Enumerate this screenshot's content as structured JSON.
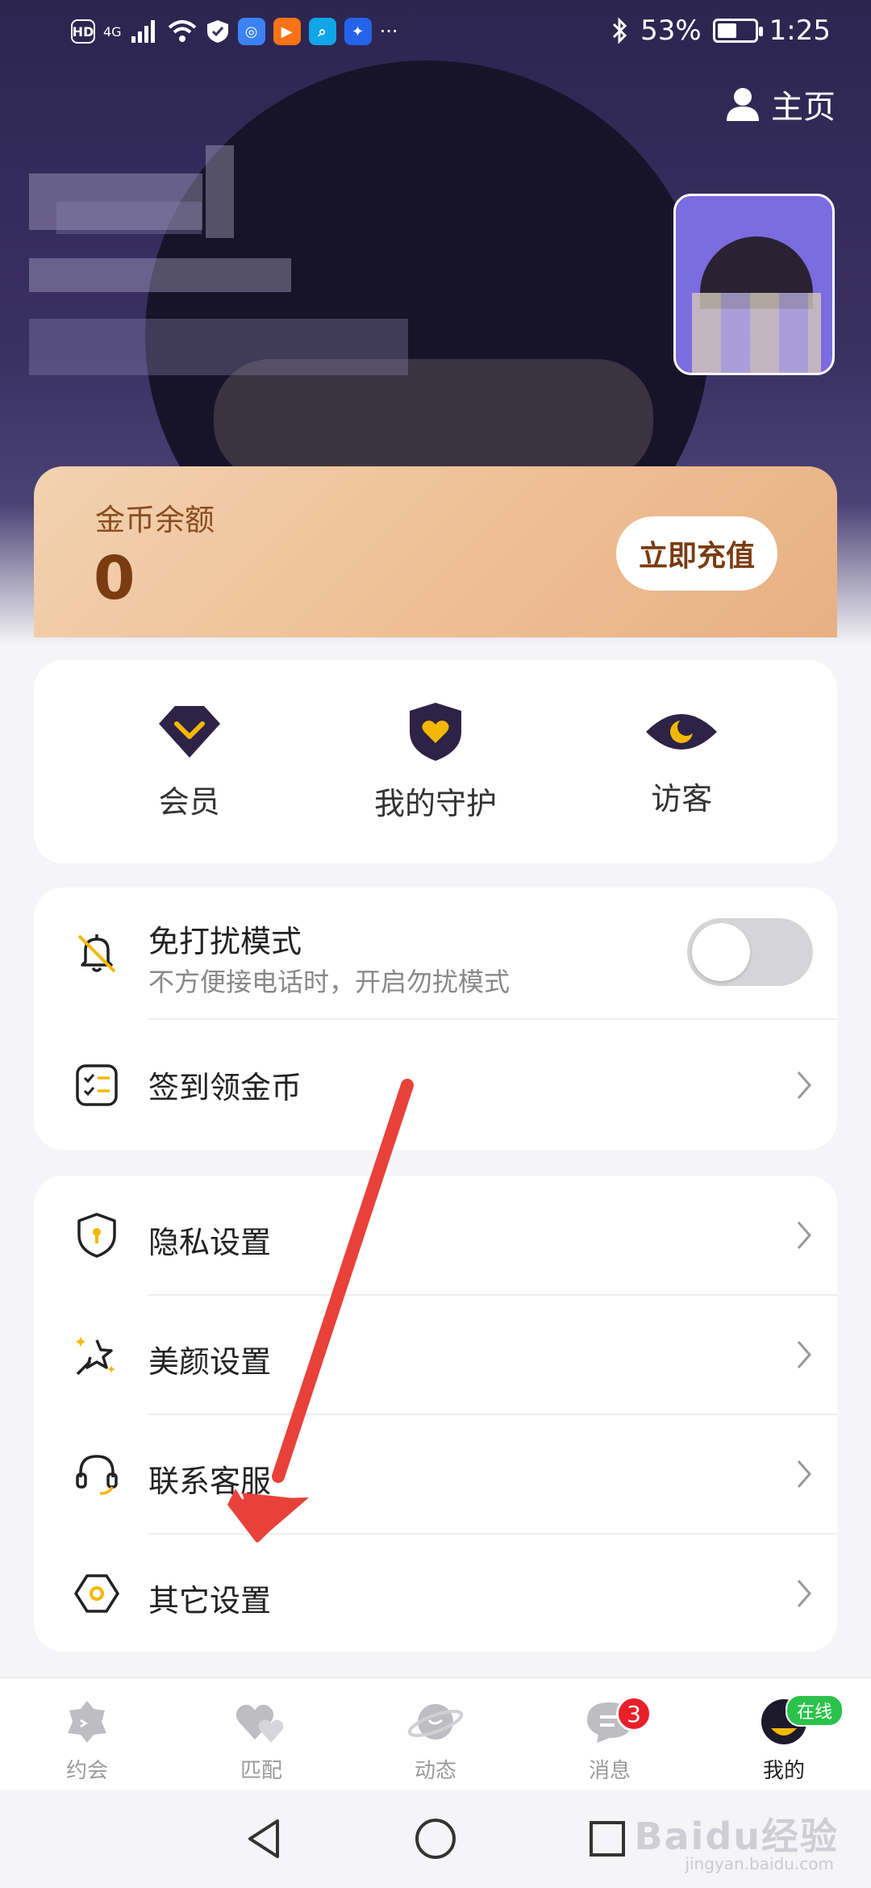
{
  "status_bar": {
    "left_chips": [
      "HD",
      "4G"
    ],
    "battery_percent_text": "53%",
    "battery_level": 0.53,
    "time": "1:25",
    "more": "···"
  },
  "header": {
    "home_label": "主页"
  },
  "coin_card": {
    "label": "金币余额",
    "value": "0",
    "recharge_label": "立即充值"
  },
  "quick_actions": [
    {
      "label": "会员",
      "icon": "vip-diamond-icon"
    },
    {
      "label": "我的守护",
      "icon": "heart-shield-icon"
    },
    {
      "label": "访客",
      "icon": "eye-moon-icon"
    }
  ],
  "settings": {
    "dnd": {
      "title": "免打扰模式",
      "subtitle": "不方便接电话时，开启勿扰模式",
      "enabled": false
    },
    "checkin": {
      "title": "签到领金币"
    },
    "privacy": {
      "title": "隐私设置"
    },
    "beauty": {
      "title": "美颜设置"
    },
    "support": {
      "title": "联系客服"
    },
    "other": {
      "title": "其它设置"
    }
  },
  "tabbar": {
    "tabs": [
      {
        "label": "约会"
      },
      {
        "label": "匹配"
      },
      {
        "label": "动态"
      },
      {
        "label": "消息",
        "badge": "3"
      },
      {
        "label": "我的",
        "badge": "在线"
      }
    ],
    "active_index": 4
  },
  "watermark": {
    "text": "Baidu经验",
    "sub": "jingyan.baidu.com"
  },
  "colors": {
    "accent_dark": "#2c2550",
    "coin_text": "#7a3c10",
    "badge_red": "#e8202a",
    "online_green": "#2bc24b",
    "annotation_arrow": "#e8413a"
  }
}
